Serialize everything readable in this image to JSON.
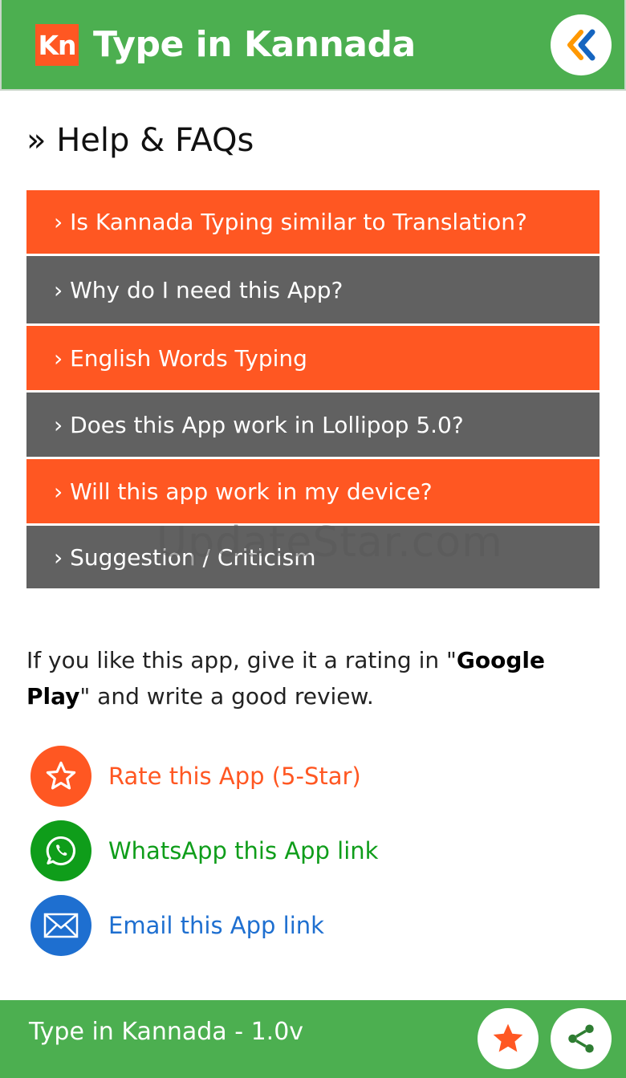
{
  "header": {
    "logo_text": "Kn",
    "title": "Type in Kannada",
    "back_icon": "double-chevron-left-icon"
  },
  "section_title": "» Help & FAQs",
  "faq_items": [
    {
      "label": "› Is Kannada Typing similar to Translation?",
      "color": "#ff5722"
    },
    {
      "label": "› Why do I need this App?",
      "color": "#616161"
    },
    {
      "label": "› English Words Typing",
      "color": "#ff5722"
    },
    {
      "label": "› Does this App work in Lollipop 5.0?",
      "color": "#616161"
    },
    {
      "label": "› Will this app work in my device?",
      "color": "#ff5722"
    },
    {
      "label": "› Suggestion / Criticism",
      "color": "#616161"
    }
  ],
  "watermark": "UpdateStar.com",
  "rating": {
    "before": "If you like this app, give it a rating in \"",
    "store": "Google Play",
    "after": "\" and write a good review."
  },
  "actions": [
    {
      "label": "Rate this App (5-Star)",
      "icon": "star-outline-icon",
      "color": "#ff5722"
    },
    {
      "label": "WhatsApp this App link",
      "icon": "whatsapp-icon",
      "color": "#0f9d1a"
    },
    {
      "label": "Email this App link",
      "icon": "envelope-icon",
      "color": "#1e6fd0"
    }
  ],
  "footer": {
    "title": "Type in Kannada - 1.0v",
    "rate_icon": "star-icon",
    "share_icon": "share-icon"
  },
  "colors": {
    "primary": "#4caf50",
    "accent": "#ff5722",
    "gray": "#616161",
    "whatsapp": "#0f9d1a",
    "email": "#1e6fd0"
  }
}
